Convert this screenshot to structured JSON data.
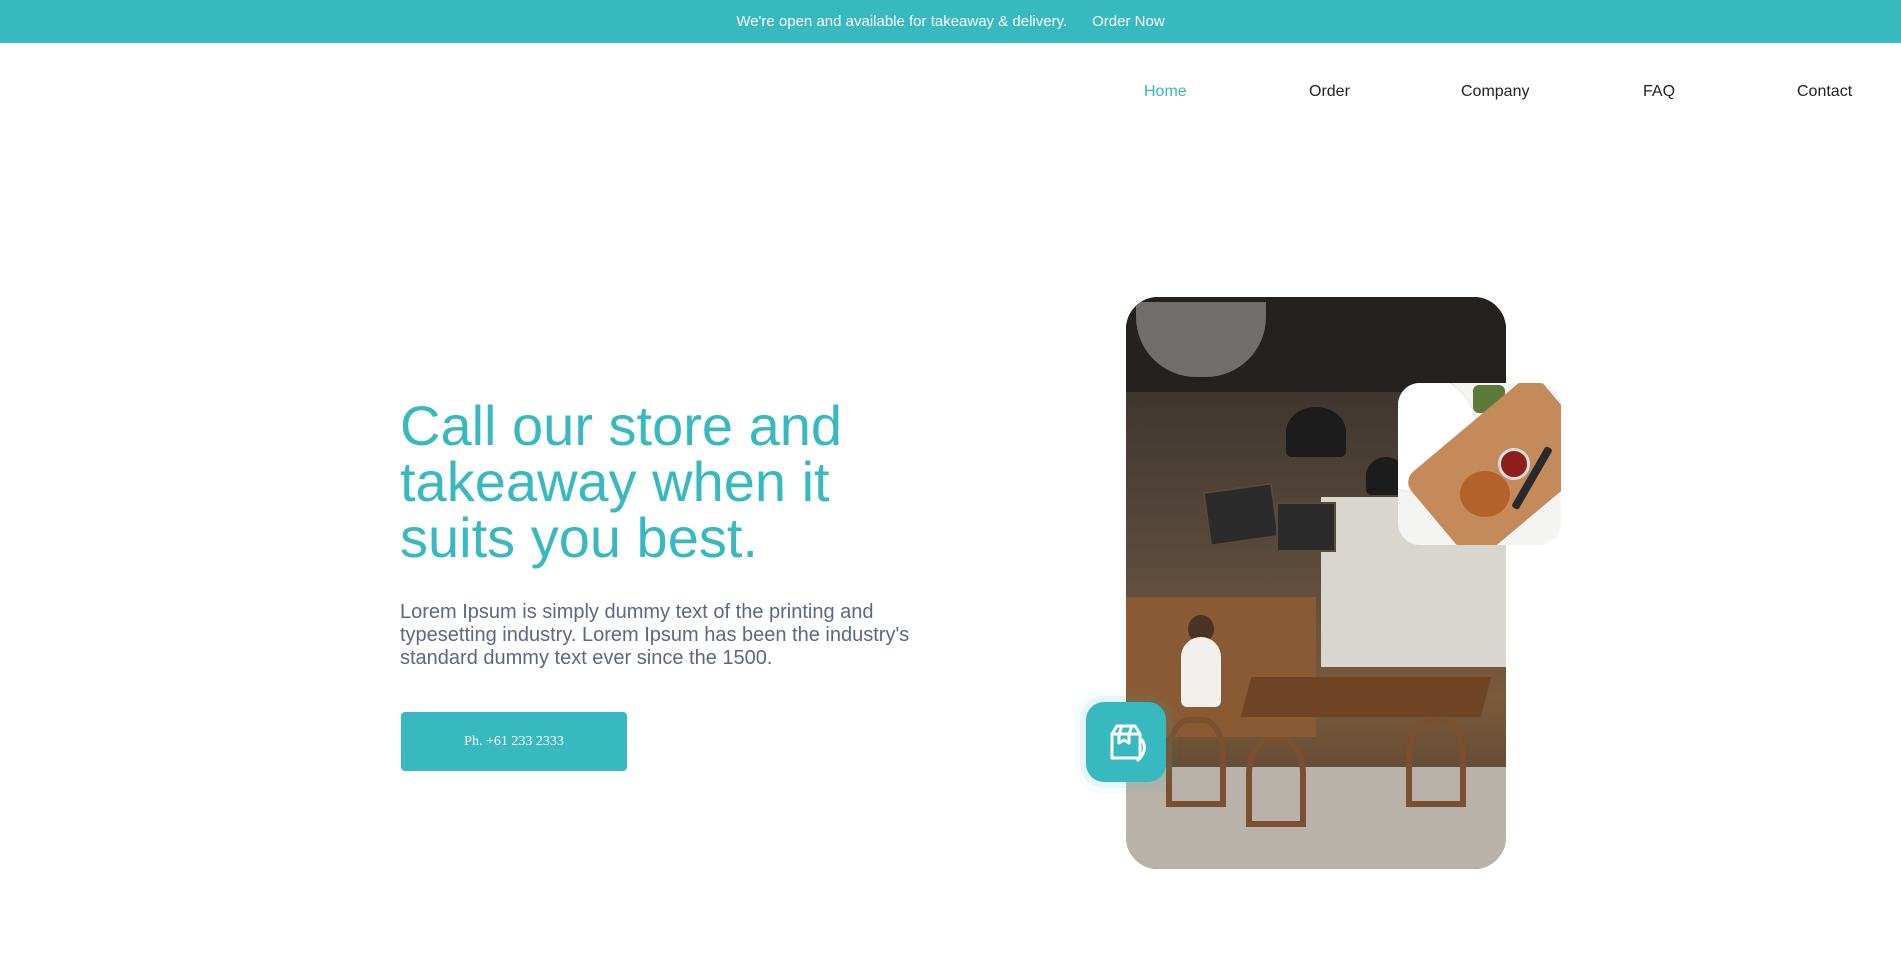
{
  "announcement": {
    "message": "We're open and available for takeaway & delivery.",
    "cta_label": "Order Now"
  },
  "nav": {
    "items": [
      {
        "label": "Home",
        "active": true
      },
      {
        "label": "Order",
        "active": false
      },
      {
        "label": "Company",
        "active": false
      },
      {
        "label": "FAQ",
        "active": false
      },
      {
        "label": "Contact",
        "active": false
      }
    ]
  },
  "hero": {
    "title": "Call our store and takeaway when it suits you best.",
    "description": "Lorem Ipsum is simply dummy text of the printing and typesetting industry. Lorem Ipsum has been the industry's standard dummy text ever since the 1500.",
    "phone_button_label": "Ph. +61 233 2333"
  },
  "media": {
    "main_photo": "cafe-interior",
    "secondary_photo": "burger-on-board",
    "badge_icon": "delivery-box-icon"
  },
  "colors": {
    "accent": "#37b9bf",
    "text_dark": "#222222",
    "text_body": "#5a6886",
    "background": "#ffffff"
  }
}
